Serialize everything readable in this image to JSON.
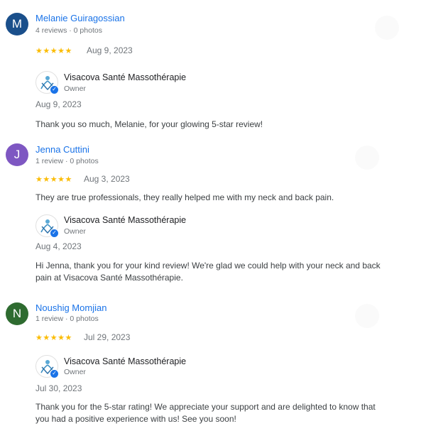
{
  "colors": {
    "name_link": "#1a73e8",
    "star": "#fbbc04",
    "avatar_m": "#1a4f8b",
    "avatar_j": "#7e57c2",
    "avatar_n": "#2e6b30"
  },
  "reviews": [
    {
      "avatar_letter": "M",
      "name": "Melanie Guiragossian",
      "meta": "4 reviews · 0 photos",
      "stars": "★★★★★",
      "date": "Aug 9, 2023",
      "text": "",
      "owner": {
        "name": "Visacova Santé Massothérapie",
        "role": "Owner",
        "date": "Aug 9, 2023",
        "reply": [
          "Thank you so much, Melanie, for your glowing 5-star review!"
        ]
      }
    },
    {
      "avatar_letter": "J",
      "name": "Jenna Cuttini",
      "meta": "1 review · 0 photos",
      "stars": "★★★★★",
      "date": "Aug 3, 2023",
      "text": "They are true professionals, they really helped me with my neck and back pain.",
      "owner": {
        "name": "Visacova Santé Massothérapie",
        "role": "Owner",
        "date": "Aug 4, 2023",
        "reply": [
          "Hi Jenna, thank you for your kind review! We're glad we could help with your neck and back",
          "pain at Visacova Santé Massothérapie."
        ]
      }
    },
    {
      "avatar_letter": "N",
      "name": "Noushig Momjian",
      "meta": "1 review · 0 photos",
      "stars": "★★★★★",
      "date": "Jul 29, 2023",
      "text": "",
      "owner": {
        "name": "Visacova Santé Massothérapie",
        "role": "Owner",
        "date": "Jul 30, 2023",
        "reply": [
          "Thank you for the 5-star rating! We appreciate your support and are delighted to know that",
          "you had a positive experience with us! See you soon!"
        ]
      }
    }
  ]
}
